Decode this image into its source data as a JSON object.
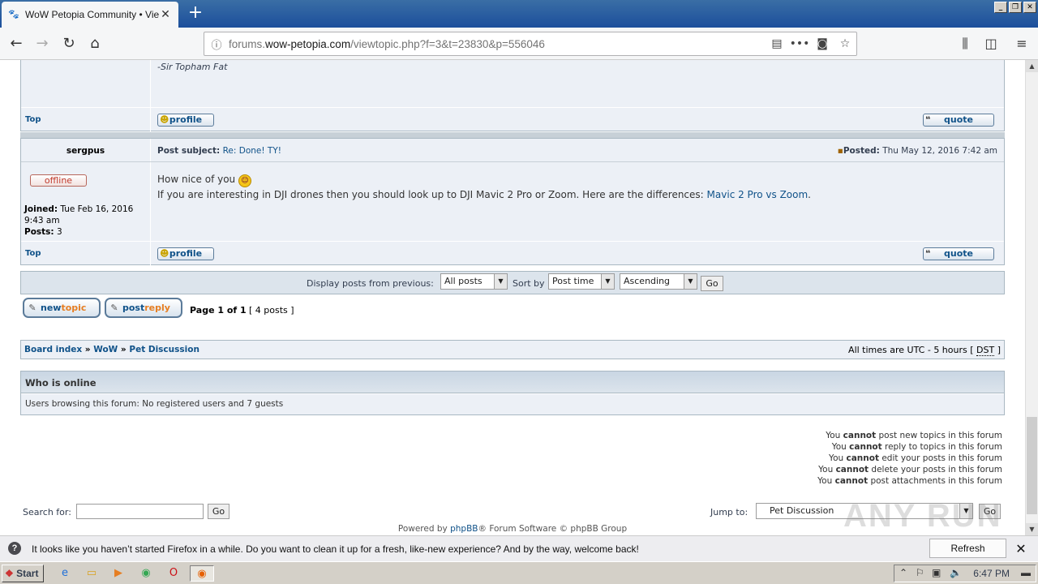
{
  "browser": {
    "tab_title": "WoW Petopia Community • View topic",
    "url_prefix": "forums.",
    "url_domain": "wow-petopia.com",
    "url_path": "/viewtopic.php?f=3&t=23830&p=556046"
  },
  "prev_post": {
    "signature": "-Sir Topham Fat",
    "top_link": "Top",
    "profile_label": "profile",
    "quote_label": "quote"
  },
  "post": {
    "author": "sergpus",
    "subject_label": "Post subject:",
    "subject": "Re: Done! TY!",
    "posted_label": "Posted:",
    "posted_date": "Thu May 12, 2016 7:42 am",
    "status": "offline",
    "joined_label": "Joined:",
    "joined": "Tue Feb 16, 2016 9:43 am",
    "posts_label": "Posts:",
    "posts": "3",
    "line1": "How nice of you",
    "line2": "If you are interesting in DJI drones then you should look up to DJI Mavic 2 Pro or Zoom. Here are the differences:",
    "link_text": "Mavic 2 Pro vs Zoom",
    "line2_end": ".",
    "top_link": "Top",
    "profile_label": "profile",
    "quote_label": "quote"
  },
  "sortbar": {
    "display_label": "Display posts from previous:",
    "display_value": "All posts",
    "sort_label": "Sort by",
    "sort_value": "Post time",
    "order_value": "Ascending",
    "go": "Go"
  },
  "pagination": {
    "newtopic_a": "new",
    "newtopic_b": "topic",
    "postreply_a": "post",
    "postreply_b": "reply",
    "page_text": "Page 1 of 1",
    "posts_count": "[ 4 posts ]"
  },
  "breadcrumb": {
    "board": "Board index",
    "sep": "»",
    "wow": "WoW",
    "forum": "Pet Discussion",
    "times_prefix": "All times are UTC - 5 hours [",
    "dst": "DST",
    "times_suffix": "]"
  },
  "online": {
    "title": "Who is online",
    "text": "Users browsing this forum: No registered users and 7 guests"
  },
  "permissions": [
    {
      "pre": "You",
      "b": "cannot",
      "post": "post new topics in this forum"
    },
    {
      "pre": "You",
      "b": "cannot",
      "post": "reply to topics in this forum"
    },
    {
      "pre": "You",
      "b": "cannot",
      "post": "edit your posts in this forum"
    },
    {
      "pre": "You",
      "b": "cannot",
      "post": "delete your posts in this forum"
    },
    {
      "pre": "You",
      "b": "cannot",
      "post": "post attachments in this forum"
    }
  ],
  "search": {
    "label": "Search for:",
    "value": "",
    "go": "Go"
  },
  "jump": {
    "label": "Jump to:",
    "value": "Pet Discussion",
    "go": "Go"
  },
  "footer": {
    "powered_prefix": "Powered by",
    "phpbb": "phpBB",
    "powered_suffix": "® Forum Software © phpBB Group"
  },
  "notification": {
    "message": "It looks like you haven’t started Firefox in a while. Do you want to clean it up for a fresh, like-new experience? And by the way, welcome back!",
    "button": "Refresh Firefox…"
  },
  "taskbar": {
    "start": "Start",
    "clock": "6:47 PM"
  },
  "watermark": "ANY RUN"
}
